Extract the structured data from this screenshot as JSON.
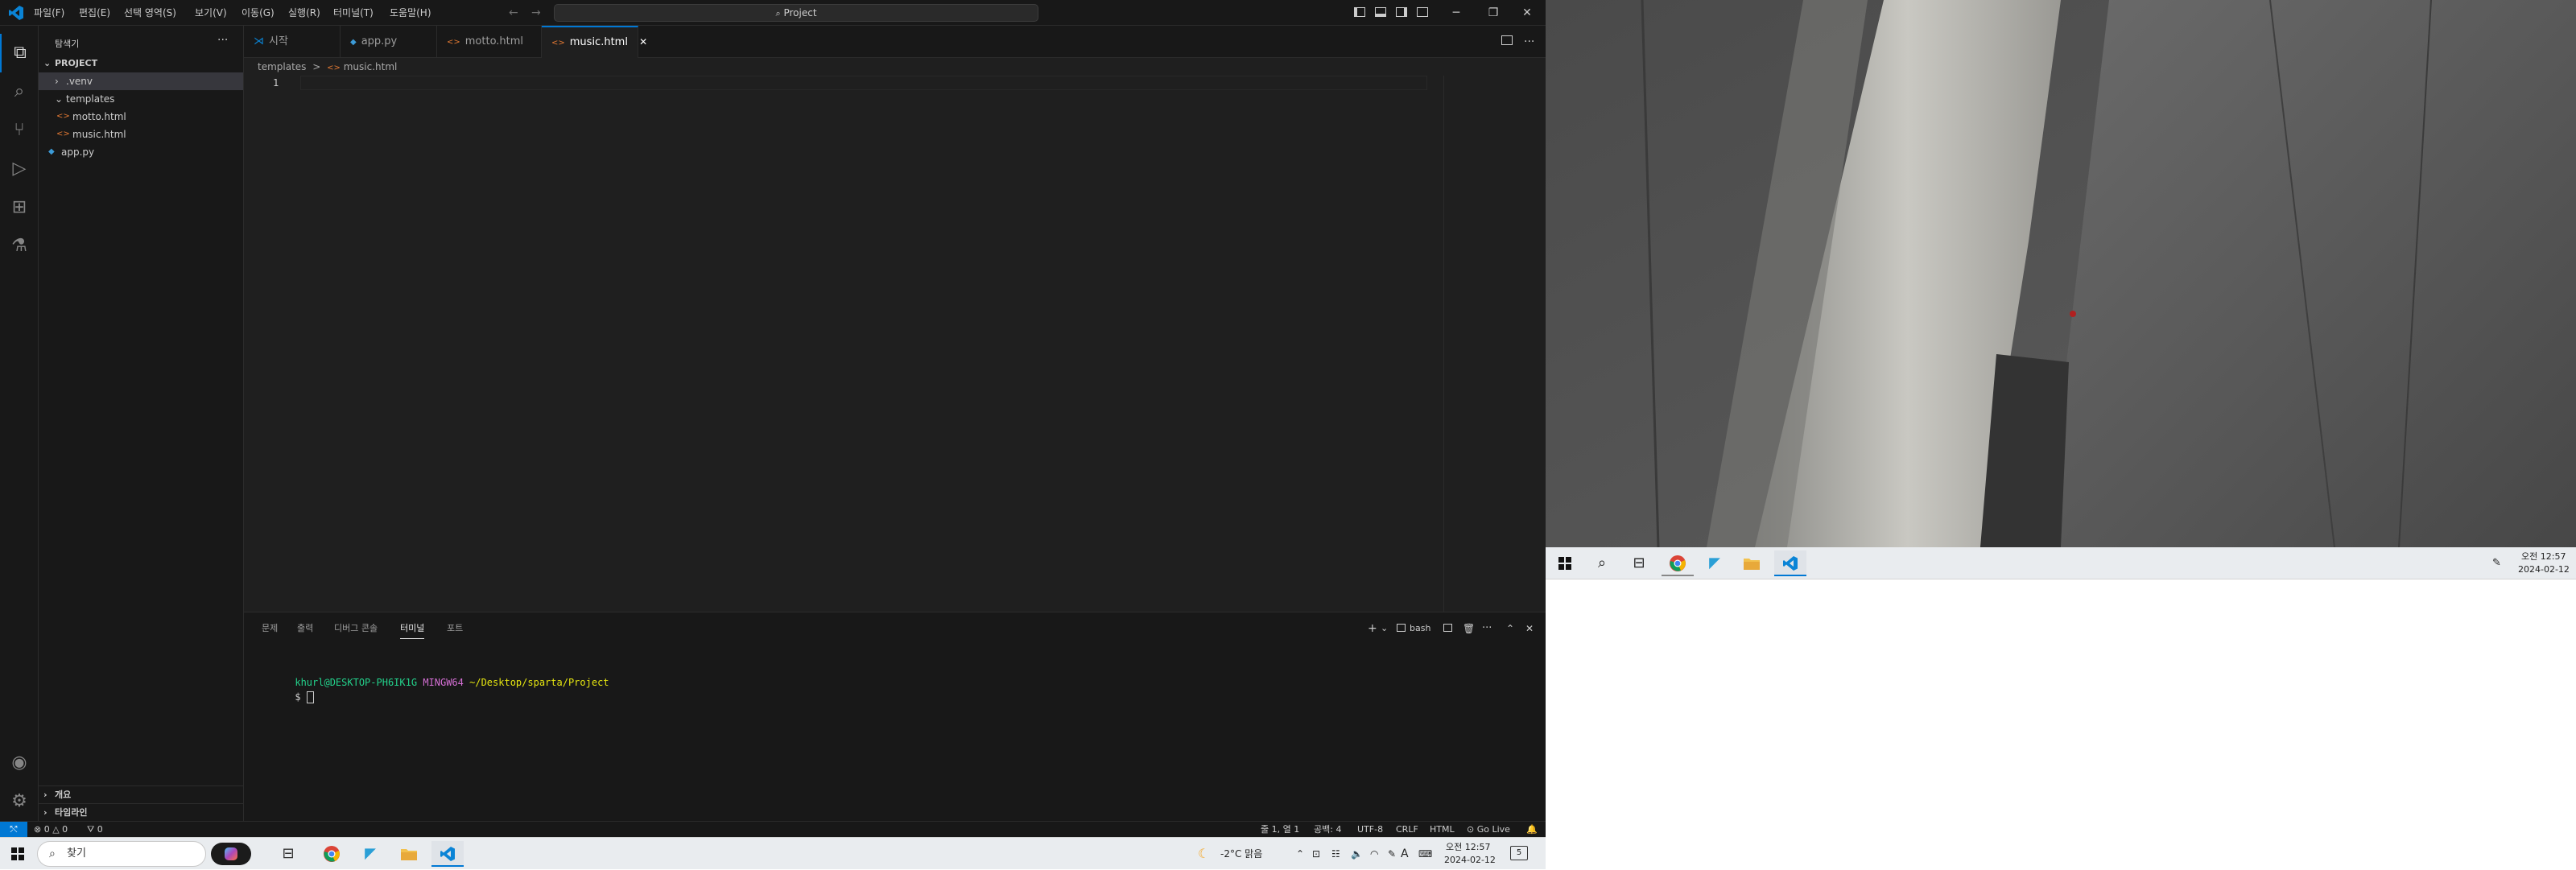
{
  "menu": [
    "파일(F)",
    "편집(E)",
    "선택 영역(S)",
    "보기(V)",
    "이동(G)",
    "실행(R)",
    "터미널(T)",
    "도움말(H)"
  ],
  "command_center": {
    "label": "Project"
  },
  "window_controls": {
    "minimize": "─",
    "restore": "❐",
    "close": "✕"
  },
  "sidebar": {
    "title": "탐색기",
    "more": "···",
    "project": "PROJECT",
    "tree": [
      ".venv",
      "templates",
      "motto.html",
      "music.html",
      "app.py"
    ],
    "outline": "개요",
    "timeline": "타임라인"
  },
  "tabs": [
    {
      "label": "시작",
      "icon": "⋊"
    },
    {
      "label": "app.py",
      "icon": "◆"
    },
    {
      "label": "motto.html",
      "icon": "<>"
    },
    {
      "label": "music.html",
      "icon": "<>",
      "close": "✕"
    }
  ],
  "breadcrumb": {
    "folder": "templates",
    "sep": ">",
    "file": "music.html"
  },
  "editor": {
    "line_number": "1"
  },
  "panel": {
    "tabs": [
      "문제",
      "출력",
      "디버그 콘솔",
      "터미널",
      "포트"
    ],
    "shell": "bash",
    "terminal": {
      "user": "khurl@DESKTOP-PH6IK1G",
      "env": "MINGW64",
      "path": "~/Desktop/sparta/Project",
      "prompt": "$"
    }
  },
  "statusbar": {
    "remote": "⤲",
    "problems": "⊗ 0 △ 0",
    "ports": "⛛ 0",
    "position": "줄 1, 열 1",
    "spaces": "공백: 4",
    "encoding": "UTF-8",
    "eol": "CRLF",
    "language": "HTML",
    "golive": "Go Live"
  },
  "taskbar": {
    "search": "찾기",
    "weather": "-2°C 맑음",
    "time": "오전 12:57",
    "date": "2024-02-12",
    "ime": "A",
    "notif": "5"
  },
  "desk_taskbar": {
    "time": "오전 12:57",
    "date": "2024-02-12"
  },
  "colors": {
    "accent": "#0078d4",
    "term_user": "#23d18b",
    "term_env": "#d670d6",
    "term_path": "#e5e510",
    "html_icon": "#e37933",
    "py_icon": "#3c9bd7"
  }
}
